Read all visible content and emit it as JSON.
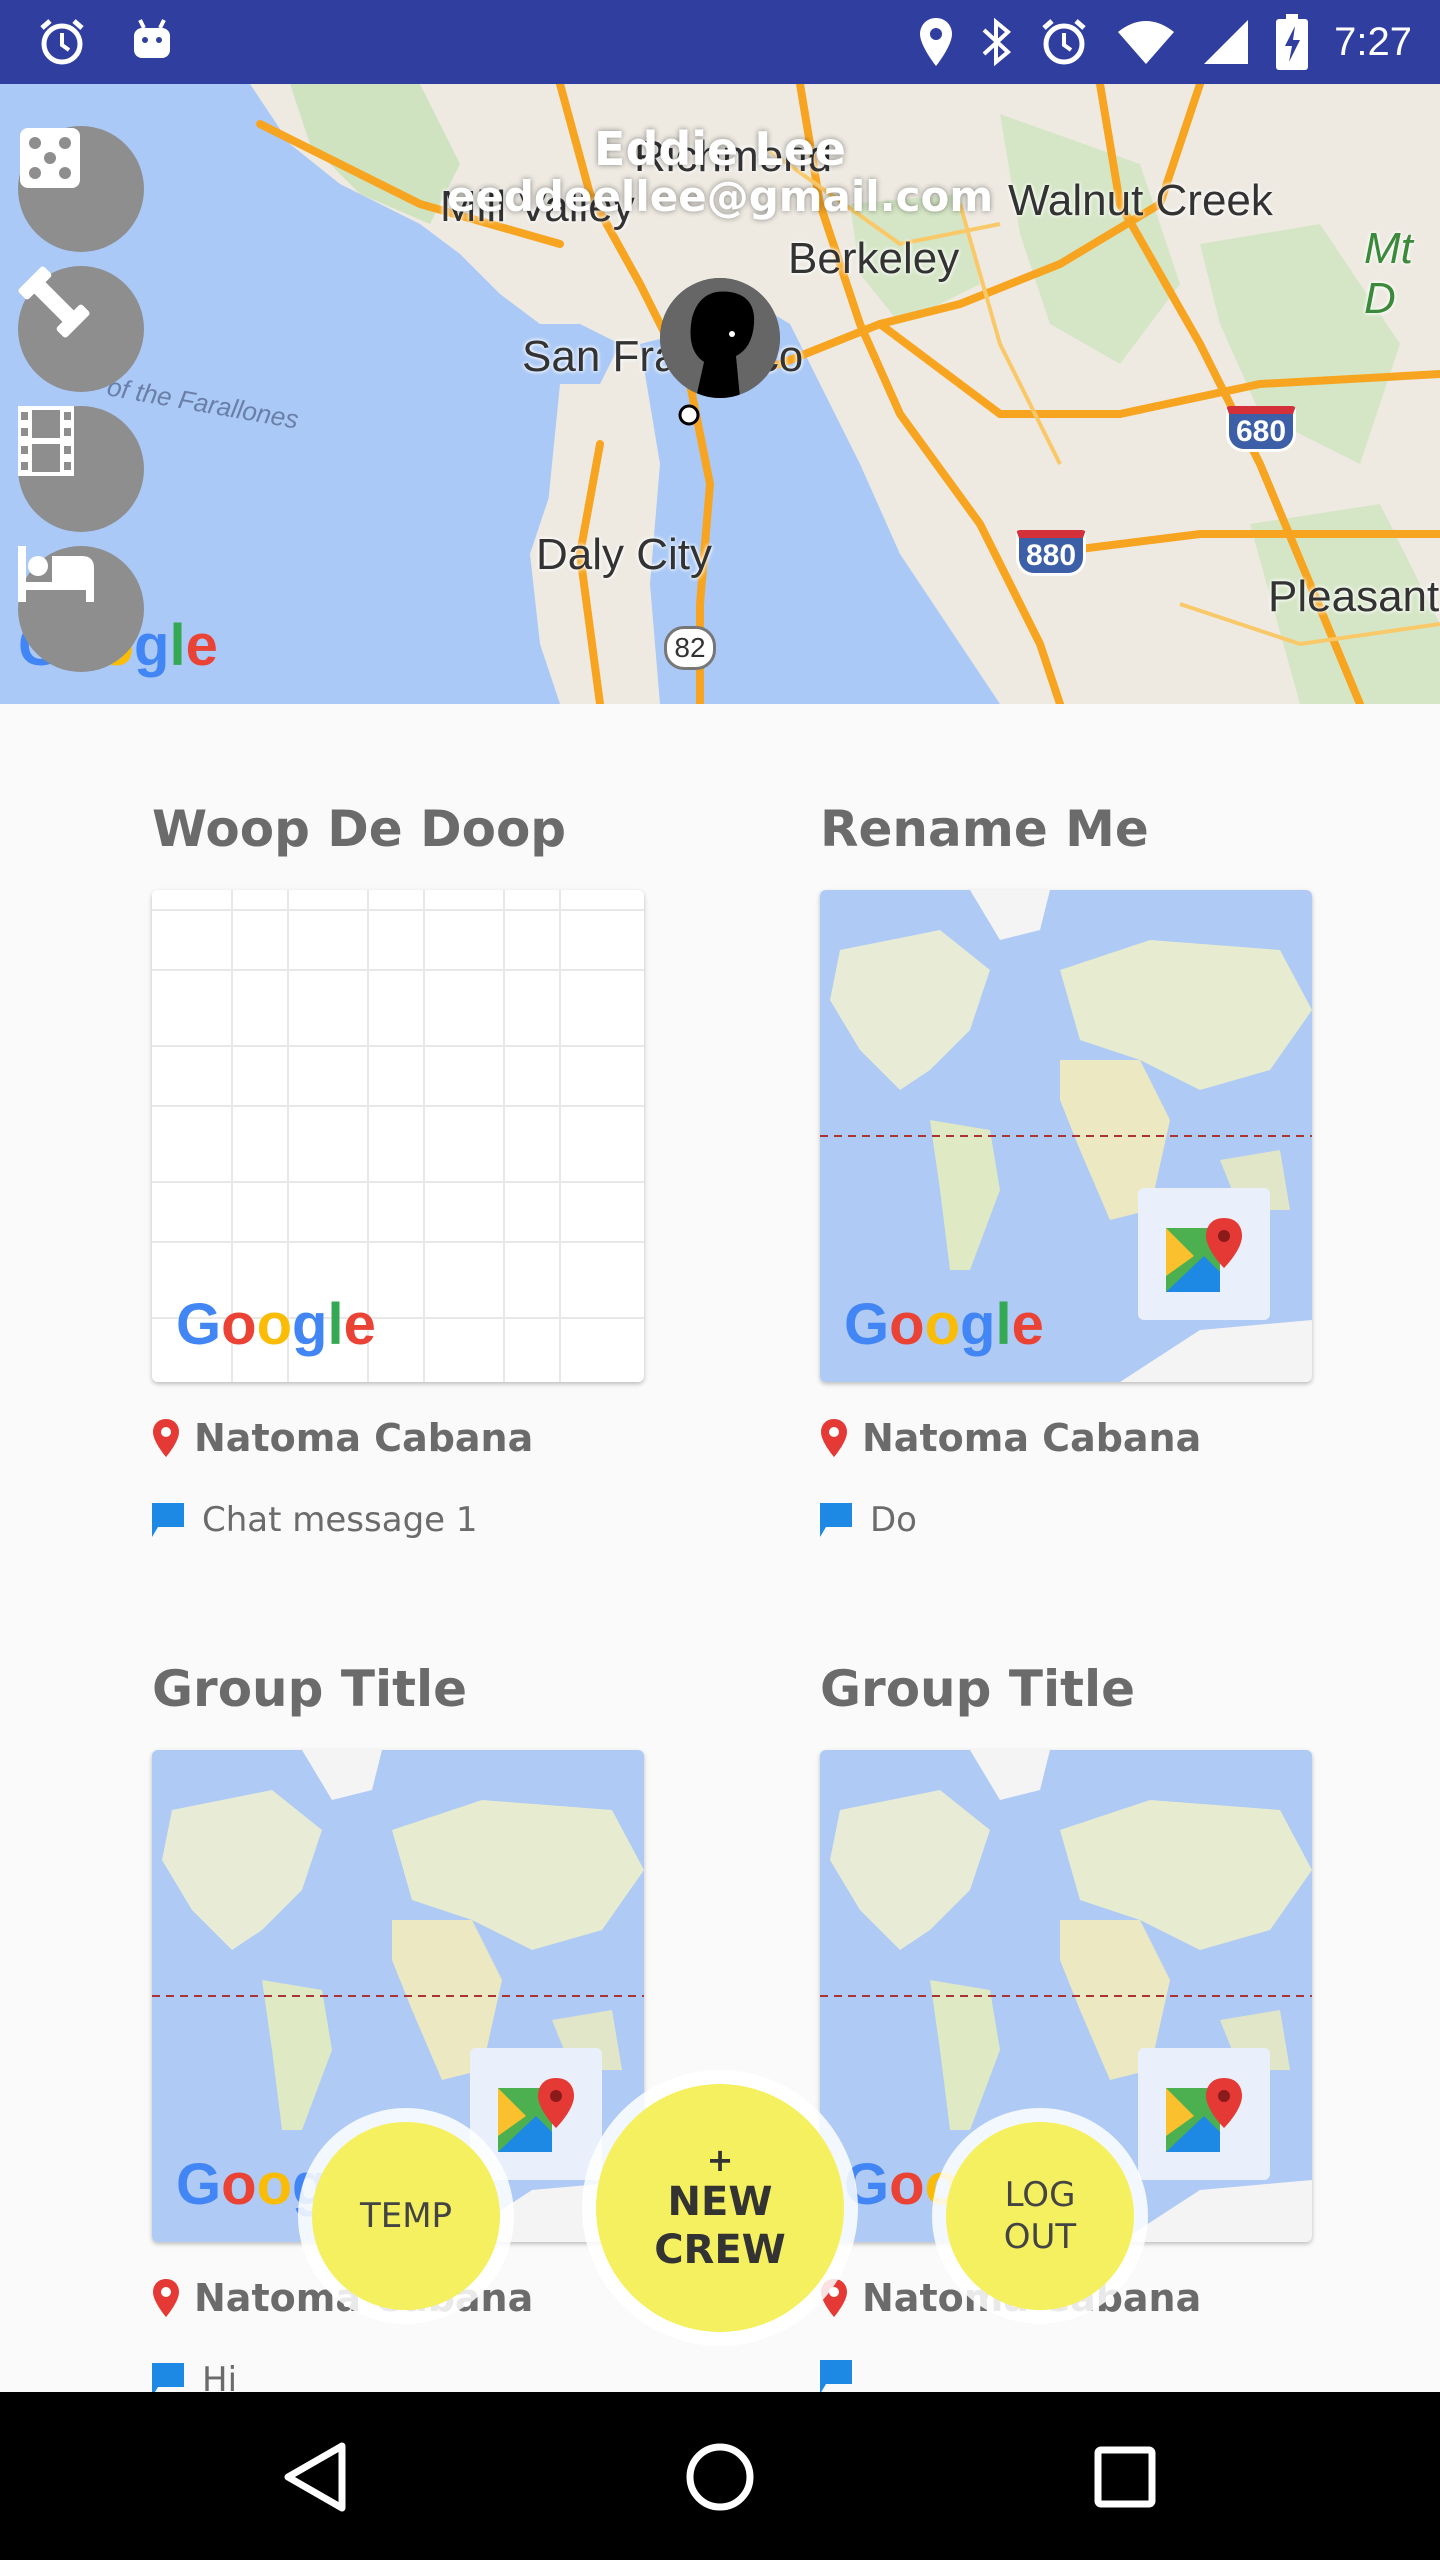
{
  "status_bar": {
    "time": "7:27",
    "left_icons": [
      "alarm-icon",
      "android-icon"
    ],
    "right_icons": [
      "location-icon",
      "bluetooth-icon",
      "alarm-icon",
      "wifi-icon",
      "signal-icon",
      "battery-charging-icon"
    ],
    "background": "#303f9f"
  },
  "header": {
    "user_name": "Eddie Lee",
    "user_email": "eeddeellee@gmail.com",
    "side_buttons": [
      "dice-icon",
      "fitness-icon",
      "movie-icon",
      "hotel-icon"
    ],
    "map_labels": {
      "richmond": "Richmond",
      "walnut_creek": "Walnut Creek",
      "berkeley": "Berkeley",
      "mt_d": "Mt D",
      "san_francisco": "San Francisco",
      "farallones": "of the Farallones",
      "daly_city": "Daly City",
      "pleasant": "Pleasant",
      "mill_valley": "Mill Valley",
      "hwy_680": "680",
      "hwy_880": "880",
      "hwy_82": "82",
      "google": "Google"
    }
  },
  "groups": [
    {
      "title": "Woop De Doop",
      "location": "Natoma Cabana",
      "message": "Chat message 1",
      "thumb": "blank-map",
      "google": "Google"
    },
    {
      "title": "Rename Me",
      "location": "Natoma Cabana",
      "message": "Do",
      "thumb": "world-map",
      "google": "Google"
    },
    {
      "title": "Group Title",
      "location": "Natoma Cabana",
      "message": "Hi",
      "thumb": "world-map",
      "google": "Google"
    },
    {
      "title": "Group Title",
      "location": "Natoma Cabana",
      "message": "",
      "thumb": "world-map",
      "google": "Google"
    }
  ],
  "fabs": {
    "temp": "TEMP",
    "new_crew_plus": "+",
    "new_crew_line1": "NEW",
    "new_crew_line2": "CREW",
    "logout_line1": "LOG",
    "logout_line2": "OUT",
    "color": "#f5f060"
  },
  "nav_bar": [
    "back-icon",
    "home-icon",
    "recents-icon"
  ]
}
